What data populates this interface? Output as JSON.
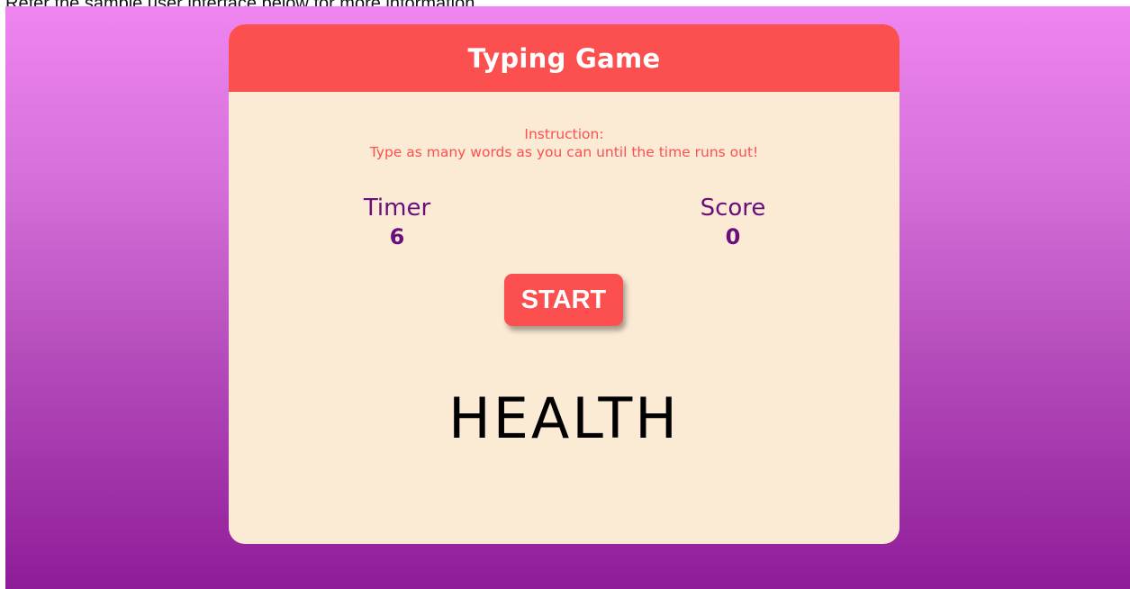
{
  "caption": "Refer the sample user interface below for more information.",
  "colors": {
    "background_top": "#ef85f0",
    "background_bottom": "#8f1c98",
    "card": "#fbead4",
    "accent": "#fc5050",
    "stat_text": "#6a0e7e",
    "word_text": "#000000"
  },
  "game": {
    "title": "Typing Game",
    "instruction_heading": "Instruction:",
    "instruction_text": "Type as many words as you can until the time runs out!",
    "timer": {
      "label": "Timer",
      "value": "6"
    },
    "score": {
      "label": "Score",
      "value": "0"
    },
    "start_label": "START",
    "current_word": "HEALTH"
  }
}
